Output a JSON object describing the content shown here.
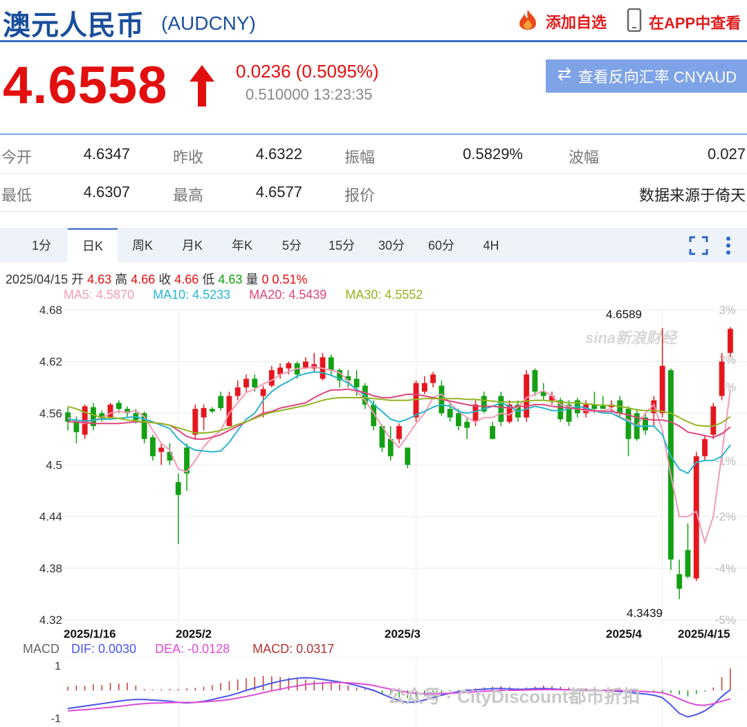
{
  "header": {
    "title": "澳元人民币",
    "code": "(AUDCNY)",
    "favorite_label": "添加自选",
    "app_label": "在APP中查看",
    "flame_icon": "flame-icon",
    "phone_icon": "phone-icon"
  },
  "price": {
    "last": "4.6558",
    "direction": "up",
    "change": "0.0236 (0.5095%)",
    "sub_value": "0.510000",
    "time": "13:23:35",
    "reverse_label": "查看反向汇率 CNYAUD",
    "up_color": "#e20f0f",
    "down_color": "#0ca20c"
  },
  "quote": {
    "rows": [
      [
        {
          "label": "今开",
          "value": "4.6347"
        },
        {
          "label": "昨收",
          "value": "4.6322"
        },
        {
          "label": "振幅",
          "value": "0.5829%"
        },
        {
          "label": "波幅",
          "value": "0.027"
        }
      ],
      [
        {
          "label": "最低",
          "value": "4.6307"
        },
        {
          "label": "最高",
          "value": "4.6577"
        },
        {
          "label": "报价",
          "value": ""
        },
        {
          "label": "",
          "value": "数据来源于倚天"
        }
      ]
    ]
  },
  "tabs": [
    {
      "label": "1分",
      "active": false
    },
    {
      "label": "日K",
      "active": true
    },
    {
      "label": "周K",
      "active": false
    },
    {
      "label": "月K",
      "active": false
    },
    {
      "label": "年K",
      "active": false
    },
    {
      "label": "5分",
      "active": false
    },
    {
      "label": "15分",
      "active": false
    },
    {
      "label": "30分",
      "active": false
    },
    {
      "label": "60分",
      "active": false
    },
    {
      "label": "4H",
      "active": false
    }
  ],
  "ohlc": {
    "date": "2025/04/15",
    "open_label": "开",
    "open": "4.63",
    "high_label": "高",
    "high": "4.66",
    "close_label": "收",
    "close": "4.66",
    "low_label": "低",
    "low": "4.63",
    "vol_label": "量",
    "vol": "0",
    "pct": "0.51%"
  },
  "ma": [
    {
      "label": "MA5: 4.5870",
      "color": "#f29bb7"
    },
    {
      "label": "MA10: 4.5233",
      "color": "#27b5cf"
    },
    {
      "label": "MA20: 4.5439",
      "color": "#e0457b"
    },
    {
      "label": "MA30: 4.5552",
      "color": "#93b41f"
    }
  ],
  "macd": {
    "title": "MACD",
    "dif_label": "DIF: 0.0030",
    "dif_color": "#4a56e8",
    "dea_label": "DEA: -0.0128",
    "dea_color": "#e04bd8",
    "macd_label": "MACD: 0.0317",
    "macd_color": "#b13030",
    "y_ticks": [
      "1",
      "-1"
    ]
  },
  "watermarks": {
    "sina": "sina新浪财经",
    "wechat": "公众号 · CityDiscount都市折扣"
  },
  "chart_data": {
    "type": "candlestick",
    "y_range": [
      4.32,
      4.68
    ],
    "y_ticks": [
      "4.68",
      "4.62",
      "4.56",
      "4.5",
      "4.44",
      "4.38",
      "4.32"
    ],
    "pct_ticks": [
      "3%",
      "2%",
      "1%",
      "-1%",
      "-2%",
      "-4%",
      "-5%"
    ],
    "x_labels": [
      "2025/1/16",
      "2025/2",
      "2025/3",
      "2025/4",
      "2025/4/15"
    ],
    "max_label": "4.6589",
    "min_label": "4.3439",
    "candles": [
      {
        "o": 4.561,
        "c": 4.55,
        "h": 4.567,
        "l": 4.54
      },
      {
        "o": 4.55,
        "c": 4.538,
        "h": 4.556,
        "l": 4.525
      },
      {
        "o": 4.535,
        "c": 4.568,
        "h": 4.57,
        "l": 4.53
      },
      {
        "o": 4.567,
        "c": 4.545,
        "h": 4.572,
        "l": 4.54
      },
      {
        "o": 4.56,
        "c": 4.553,
        "h": 4.563,
        "l": 4.55
      },
      {
        "o": 4.555,
        "c": 4.57,
        "h": 4.572,
        "l": 4.553
      },
      {
        "o": 4.572,
        "c": 4.565,
        "h": 4.575,
        "l": 4.56
      },
      {
        "o": 4.565,
        "c": 4.56,
        "h": 4.568,
        "l": 4.555
      },
      {
        "o": 4.56,
        "c": 4.552,
        "h": 4.565,
        "l": 4.548
      },
      {
        "o": 4.56,
        "c": 4.53,
        "h": 4.562,
        "l": 4.525
      },
      {
        "o": 4.532,
        "c": 4.51,
        "h": 4.535,
        "l": 4.505
      },
      {
        "o": 4.515,
        "c": 4.52,
        "h": 4.525,
        "l": 4.5
      },
      {
        "o": 4.515,
        "c": 4.505,
        "h": 4.525,
        "l": 4.5
      },
      {
        "o": 4.48,
        "c": 4.465,
        "h": 4.49,
        "l": 4.408
      },
      {
        "o": 4.52,
        "c": 4.49,
        "h": 4.525,
        "l": 4.47
      },
      {
        "o": 4.535,
        "c": 4.565,
        "h": 4.57,
        "l": 4.53
      },
      {
        "o": 4.555,
        "c": 4.566,
        "h": 4.57,
        "l": 4.54
      },
      {
        "o": 4.565,
        "c": 4.562,
        "h": 4.567,
        "l": 4.56
      },
      {
        "o": 4.58,
        "c": 4.566,
        "h": 4.585,
        "l": 4.563
      },
      {
        "o": 4.545,
        "c": 4.58,
        "h": 4.585,
        "l": 4.545
      },
      {
        "o": 4.58,
        "c": 4.59,
        "h": 4.598,
        "l": 4.575
      },
      {
        "o": 4.59,
        "c": 4.6,
        "h": 4.605,
        "l": 4.585
      },
      {
        "o": 4.6,
        "c": 4.59,
        "h": 4.605,
        "l": 4.585
      },
      {
        "o": 4.58,
        "c": 4.588,
        "h": 4.592,
        "l": 4.555
      },
      {
        "o": 4.592,
        "c": 4.61,
        "h": 4.615,
        "l": 4.59
      },
      {
        "o": 4.605,
        "c": 4.613,
        "h": 4.618,
        "l": 4.6
      },
      {
        "o": 4.612,
        "c": 4.618,
        "h": 4.62,
        "l": 4.605
      },
      {
        "o": 4.618,
        "c": 4.605,
        "h": 4.62,
        "l": 4.6
      },
      {
        "o": 4.613,
        "c": 4.62,
        "h": 4.625,
        "l": 4.612
      },
      {
        "o": 4.612,
        "c": 4.617,
        "h": 4.63,
        "l": 4.608
      },
      {
        "o": 4.6,
        "c": 4.625,
        "h": 4.63,
        "l": 4.598
      },
      {
        "o": 4.625,
        "c": 4.61,
        "h": 4.628,
        "l": 4.603
      },
      {
        "o": 4.61,
        "c": 4.598,
        "h": 4.612,
        "l": 4.59
      },
      {
        "o": 4.603,
        "c": 4.598,
        "h": 4.61,
        "l": 4.59
      },
      {
        "o": 4.6,
        "c": 4.59,
        "h": 4.61,
        "l": 4.58
      },
      {
        "o": 4.592,
        "c": 4.57,
        "h": 4.595,
        "l": 4.565
      },
      {
        "o": 4.57,
        "c": 4.545,
        "h": 4.575,
        "l": 4.54
      },
      {
        "o": 4.545,
        "c": 4.52,
        "h": 4.547,
        "l": 4.515
      },
      {
        "o": 4.53,
        "c": 4.51,
        "h": 4.545,
        "l": 4.505
      },
      {
        "o": 4.53,
        "c": 4.545,
        "h": 4.548,
        "l": 4.525
      },
      {
        "o": 4.52,
        "c": 4.5,
        "h": 4.52,
        "l": 4.496
      },
      {
        "o": 4.555,
        "c": 4.595,
        "h": 4.598,
        "l": 4.55
      },
      {
        "o": 4.585,
        "c": 4.595,
        "h": 4.603,
        "l": 4.582
      },
      {
        "o": 4.595,
        "c": 4.605,
        "h": 4.608,
        "l": 4.59
      },
      {
        "o": 4.592,
        "c": 4.56,
        "h": 4.598,
        "l": 4.557
      },
      {
        "o": 4.565,
        "c": 4.555,
        "h": 4.572,
        "l": 4.55
      },
      {
        "o": 4.56,
        "c": 4.545,
        "h": 4.565,
        "l": 4.54
      },
      {
        "o": 4.55,
        "c": 4.543,
        "h": 4.555,
        "l": 4.53
      },
      {
        "o": 4.55,
        "c": 4.57,
        "h": 4.575,
        "l": 4.545
      },
      {
        "o": 4.58,
        "c": 4.562,
        "h": 4.585,
        "l": 4.56
      },
      {
        "o": 4.545,
        "c": 4.53,
        "h": 4.55,
        "l": 4.53
      },
      {
        "o": 4.58,
        "c": 4.55,
        "h": 4.585,
        "l": 4.545
      },
      {
        "o": 4.55,
        "c": 4.57,
        "h": 4.575,
        "l": 4.548
      },
      {
        "o": 4.57,
        "c": 4.555,
        "h": 4.575,
        "l": 4.55
      },
      {
        "o": 4.555,
        "c": 4.605,
        "h": 4.61,
        "l": 4.55
      },
      {
        "o": 4.61,
        "c": 4.585,
        "h": 4.612,
        "l": 4.58
      },
      {
        "o": 4.585,
        "c": 4.58,
        "h": 4.595,
        "l": 4.575
      },
      {
        "o": 4.575,
        "c": 4.58,
        "h": 4.585,
        "l": 4.57
      },
      {
        "o": 4.575,
        "c": 4.553,
        "h": 4.578,
        "l": 4.55
      },
      {
        "o": 4.57,
        "c": 4.55,
        "h": 4.575,
        "l": 4.545
      },
      {
        "o": 4.575,
        "c": 4.56,
        "h": 4.578,
        "l": 4.555
      },
      {
        "o": 4.56,
        "c": 4.57,
        "h": 4.575,
        "l": 4.555
      },
      {
        "o": 4.57,
        "c": 4.565,
        "h": 4.585,
        "l": 4.56
      },
      {
        "o": 4.57,
        "c": 4.565,
        "h": 4.58,
        "l": 4.565
      },
      {
        "o": 4.567,
        "c": 4.57,
        "h": 4.575,
        "l": 4.562
      },
      {
        "o": 4.575,
        "c": 4.56,
        "h": 4.58,
        "l": 4.555
      },
      {
        "o": 4.565,
        "c": 4.53,
        "h": 4.568,
        "l": 4.51
      },
      {
        "o": 4.56,
        "c": 4.53,
        "h": 4.565,
        "l": 4.528
      },
      {
        "o": 4.555,
        "c": 4.54,
        "h": 4.56,
        "l": 4.535
      },
      {
        "o": 4.56,
        "c": 4.575,
        "h": 4.58,
        "l": 4.545
      },
      {
        "o": 4.56,
        "c": 4.615,
        "h": 4.659,
        "l": 4.555
      },
      {
        "o": 4.61,
        "c": 4.39,
        "h": 4.612,
        "l": 4.378
      },
      {
        "o": 4.373,
        "c": 4.356,
        "h": 4.39,
        "l": 4.344
      },
      {
        "o": 4.401,
        "c": 4.37,
        "h": 4.432,
        "l": 4.368
      },
      {
        "o": 4.368,
        "c": 4.51,
        "h": 4.515,
        "l": 4.365
      },
      {
        "o": 4.51,
        "c": 4.53,
        "h": 4.535,
        "l": 4.505
      },
      {
        "o": 4.535,
        "c": 4.568,
        "h": 4.572,
        "l": 4.53
      },
      {
        "o": 4.58,
        "c": 4.62,
        "h": 4.63,
        "l": 4.575
      },
      {
        "o": 4.63,
        "c": 4.658,
        "h": 4.66,
        "l": 4.625
      }
    ],
    "ma_series": [
      {
        "name": "MA5",
        "values": [
          4.555,
          4.55,
          4.548,
          4.552,
          4.555,
          4.56,
          4.562,
          4.561,
          4.563,
          4.556,
          4.54,
          4.525,
          4.517,
          4.495,
          4.492,
          4.505,
          4.521,
          4.532,
          4.54,
          4.56,
          4.572,
          4.584,
          4.588,
          4.594,
          4.598,
          4.605,
          4.608,
          4.612,
          4.612,
          4.614,
          4.612,
          4.61,
          4.607,
          4.598,
          4.585,
          4.575,
          4.56,
          4.545,
          4.53,
          4.52,
          4.534,
          4.548,
          4.56,
          4.578,
          4.582,
          4.572,
          4.562,
          4.555,
          4.55,
          4.555,
          4.555,
          4.56,
          4.558,
          4.567,
          4.578,
          4.582,
          4.586,
          4.58,
          4.57,
          4.568,
          4.565,
          4.563,
          4.562,
          4.563,
          4.565,
          4.555,
          4.552,
          4.545,
          4.56,
          4.57,
          4.54,
          4.488,
          4.44,
          4.44,
          4.446,
          4.41,
          4.44,
          4.512,
          4.587
        ]
      },
      {
        "name": "MA10",
        "values": [
          4.553,
          4.552,
          4.551,
          4.552,
          4.553,
          4.553,
          4.554,
          4.555,
          4.556,
          4.553,
          4.55,
          4.546,
          4.542,
          4.53,
          4.522,
          4.517,
          4.516,
          4.515,
          4.516,
          4.526,
          4.54,
          4.553,
          4.56,
          4.575,
          4.585,
          4.592,
          4.597,
          4.603,
          4.606,
          4.608,
          4.607,
          4.604,
          4.6,
          4.595,
          4.588,
          4.58,
          4.57,
          4.562,
          4.553,
          4.55,
          4.553,
          4.558,
          4.562,
          4.567,
          4.57,
          4.568,
          4.562,
          4.56,
          4.562,
          4.565,
          4.568,
          4.572,
          4.568,
          4.562,
          4.565,
          4.568,
          4.566,
          4.563,
          4.563,
          4.565,
          4.568,
          4.566,
          4.563,
          4.56,
          4.56,
          4.555,
          4.55,
          4.545,
          4.545,
          4.545,
          4.535,
          4.51,
          4.495,
          4.49,
          4.503,
          4.505,
          4.505,
          4.51,
          4.523
        ]
      },
      {
        "name": "MA20",
        "values": [
          4.55,
          4.55,
          4.549,
          4.548,
          4.548,
          4.548,
          4.548,
          4.549,
          4.55,
          4.55,
          4.549,
          4.548,
          4.546,
          4.54,
          4.533,
          4.53,
          4.53,
          4.532,
          4.535,
          4.54,
          4.545,
          4.55,
          4.555,
          4.56,
          4.562,
          4.566,
          4.568,
          4.57,
          4.572,
          4.578,
          4.583,
          4.587,
          4.587,
          4.588,
          4.586,
          4.584,
          4.58,
          4.578,
          4.578,
          4.58,
          4.582,
          4.582,
          4.58,
          4.578,
          4.576,
          4.574,
          4.572,
          4.57,
          4.568,
          4.568,
          4.568,
          4.567,
          4.566,
          4.568,
          4.568,
          4.57,
          4.57,
          4.568,
          4.567,
          4.566,
          4.565,
          4.564,
          4.563,
          4.562,
          4.562,
          4.56,
          4.558,
          4.555,
          4.553,
          4.552,
          4.552,
          4.55,
          4.545,
          4.538,
          4.536,
          4.534,
          4.532,
          4.536,
          4.544
        ]
      },
      {
        "name": "MA30",
        "values": [
          4.568,
          4.565,
          4.561,
          4.558,
          4.555,
          4.555,
          4.554,
          4.552,
          4.551,
          4.55,
          4.549,
          4.548,
          4.546,
          4.543,
          4.54,
          4.537,
          4.537,
          4.538,
          4.54,
          4.543,
          4.547,
          4.55,
          4.554,
          4.558,
          4.561,
          4.563,
          4.565,
          4.567,
          4.569,
          4.572,
          4.575,
          4.577,
          4.578,
          4.578,
          4.578,
          4.578,
          4.577,
          4.576,
          4.575,
          4.575,
          4.575,
          4.576,
          4.577,
          4.577,
          4.577,
          4.577,
          4.577,
          4.576,
          4.576,
          4.575,
          4.574,
          4.573,
          4.573,
          4.573,
          4.574,
          4.575,
          4.575,
          4.574,
          4.573,
          4.572,
          4.572,
          4.571,
          4.57,
          4.569,
          4.569,
          4.568,
          4.566,
          4.564,
          4.563,
          4.563,
          4.562,
          4.56,
          4.555,
          4.55,
          4.546,
          4.545,
          4.545,
          4.549,
          4.556
        ]
      }
    ],
    "macd_range": [
      -1.2,
      1.2
    ],
    "macd_bars": [
      0.15,
      0.2,
      0.18,
      0.25,
      0.22,
      0.3,
      0.28,
      0.32,
      0.2,
      0.05,
      0.03,
      0.04,
      0.06,
      0.05,
      0.08,
      0.1,
      0.15,
      0.22,
      0.3,
      0.38,
      0.45,
      0.5,
      0.55,
      0.6,
      0.58,
      0.55,
      0.52,
      0.5,
      0.45,
      0.4,
      0.35,
      0.3,
      0.25,
      0.2,
      0.12,
      0.06,
      -0.05,
      -0.12,
      -0.2,
      -0.28,
      -0.32,
      -0.3,
      -0.25,
      -0.15,
      -0.1,
      -0.05,
      0.03,
      0.05,
      0.08,
      0.12,
      0.15,
      0.18,
      0.14,
      0.1,
      0.12,
      0.16,
      0.2,
      0.18,
      0.15,
      0.12,
      0.1,
      0.08,
      0.06,
      0.05,
      0.04,
      0.03,
      0.02,
      0.01,
      0.0,
      -0.05,
      -0.08,
      -0.12,
      -0.18,
      -0.25,
      -0.15,
      -0.05,
      0.12,
      0.55,
      0.9
    ],
    "dif": [
      -0.75,
      -0.7,
      -0.65,
      -0.6,
      -0.55,
      -0.5,
      -0.45,
      -0.4,
      -0.38,
      -0.38,
      -0.4,
      -0.42,
      -0.45,
      -0.5,
      -0.52,
      -0.5,
      -0.45,
      -0.38,
      -0.3,
      -0.22,
      -0.12,
      0.0,
      0.1,
      0.2,
      0.3,
      0.38,
      0.45,
      0.5,
      0.52,
      0.5,
      0.45,
      0.4,
      0.35,
      0.28,
      0.2,
      0.1,
      0.0,
      -0.15,
      -0.3,
      -0.42,
      -0.5,
      -0.48,
      -0.4,
      -0.3,
      -0.2,
      -0.12,
      -0.05,
      0.0,
      0.02,
      0.05,
      0.07,
      0.08,
      0.06,
      0.04,
      0.05,
      0.07,
      0.08,
      0.06,
      0.04,
      0.02,
      0.01,
      0.0,
      0.0,
      0.0,
      -0.02,
      -0.05,
      -0.08,
      -0.12,
      -0.15,
      -0.2,
      -0.3,
      -0.6,
      -0.95,
      -1.1,
      -1.0,
      -0.85,
      -0.6,
      -0.25,
      0.03
    ],
    "dea": [
      -0.85,
      -0.82,
      -0.8,
      -0.77,
      -0.73,
      -0.7,
      -0.66,
      -0.62,
      -0.58,
      -0.55,
      -0.53,
      -0.52,
      -0.51,
      -0.5,
      -0.5,
      -0.5,
      -0.48,
      -0.45,
      -0.42,
      -0.38,
      -0.32,
      -0.25,
      -0.18,
      -0.1,
      -0.02,
      0.05,
      0.12,
      0.18,
      0.24,
      0.28,
      0.3,
      0.32,
      0.32,
      0.31,
      0.29,
      0.25,
      0.2,
      0.12,
      0.05,
      -0.02,
      -0.08,
      -0.12,
      -0.14,
      -0.14,
      -0.13,
      -0.12,
      -0.1,
      -0.08,
      -0.06,
      -0.04,
      -0.02,
      0.0,
      0.0,
      0.0,
      0.01,
      0.02,
      0.03,
      0.03,
      0.03,
      0.02,
      0.02,
      0.01,
      0.01,
      0.0,
      0.0,
      -0.01,
      -0.02,
      -0.04,
      -0.05,
      -0.07,
      -0.1,
      -0.2,
      -0.35,
      -0.5,
      -0.6,
      -0.62,
      -0.55,
      -0.45,
      -0.35
    ]
  }
}
